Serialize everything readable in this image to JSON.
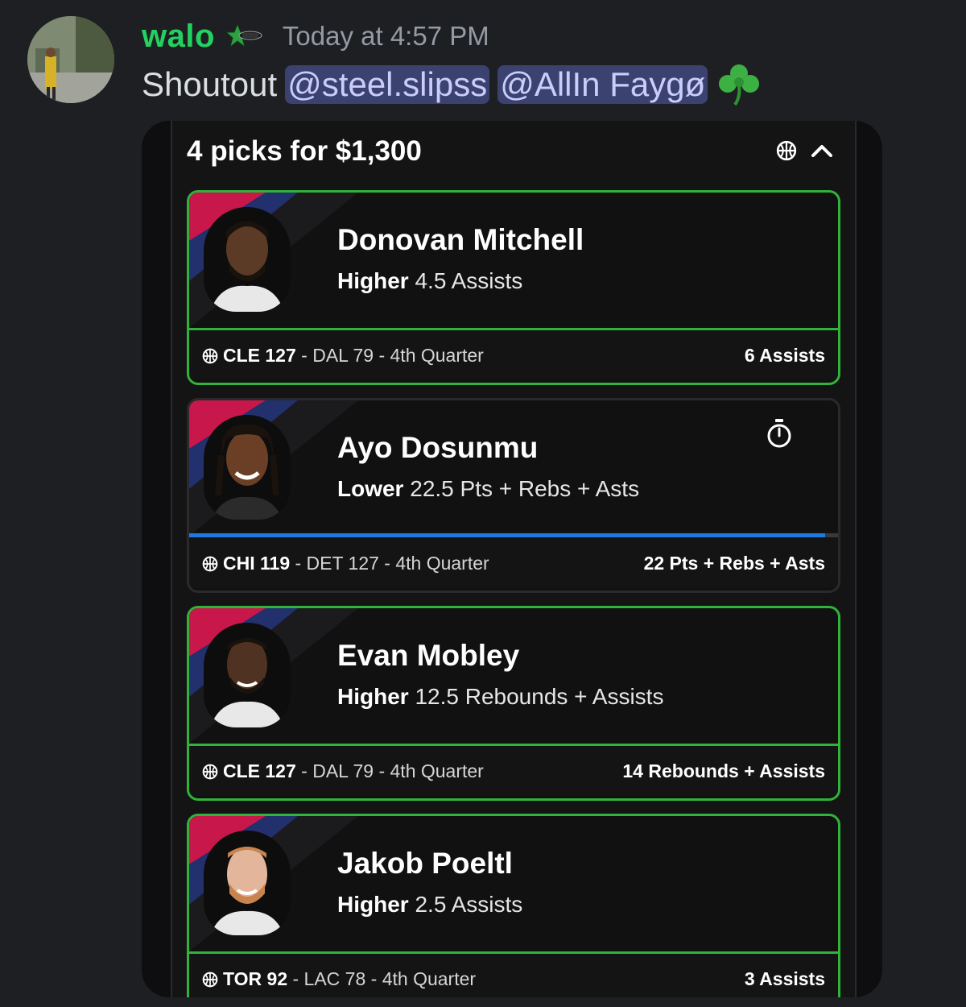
{
  "message": {
    "username": "walo",
    "timestamp": "Today at 4:57 PM",
    "text": "Shoutout",
    "mentions": [
      "@steel.slipss",
      "@AllIn Faygø"
    ],
    "emoji": "shamrock-icon",
    "colors": {
      "username": "#23d160",
      "mention_bg": "#3c4270",
      "mention_text": "#c9cdfb"
    }
  },
  "slip": {
    "title": "4 picks for $1,300",
    "colors": {
      "win": "#2fb33a",
      "progress": "#1d7be0"
    },
    "picks": [
      {
        "player": "Donovan Mitchell",
        "direction": "Higher",
        "line": "4.5 Assists",
        "team_score": "CLE 127",
        "rest": "- DAL 79 - 4th Quarter",
        "result": "6 Assists",
        "status": "hit"
      },
      {
        "player": "Ayo Dosunmu",
        "direction": "Lower",
        "line": "22.5 Pts + Rebs + Asts",
        "team_score": "CHI 119",
        "rest": "- DET 127 - 4th Quarter",
        "result": "22 Pts + Rebs + Asts",
        "status": "in-progress",
        "progress": 0.98
      },
      {
        "player": "Evan Mobley",
        "direction": "Higher",
        "line": "12.5 Rebounds + Assists",
        "team_score": "CLE 127",
        "rest": "- DAL 79 - 4th Quarter",
        "result": "14 Rebounds + Assists",
        "status": "hit"
      },
      {
        "player": "Jakob Poeltl",
        "direction": "Higher",
        "line": "2.5 Assists",
        "team_score": "TOR 92",
        "rest": "- LAC 78 - 4th Quarter",
        "result": "3 Assists",
        "status": "hit"
      }
    ]
  }
}
